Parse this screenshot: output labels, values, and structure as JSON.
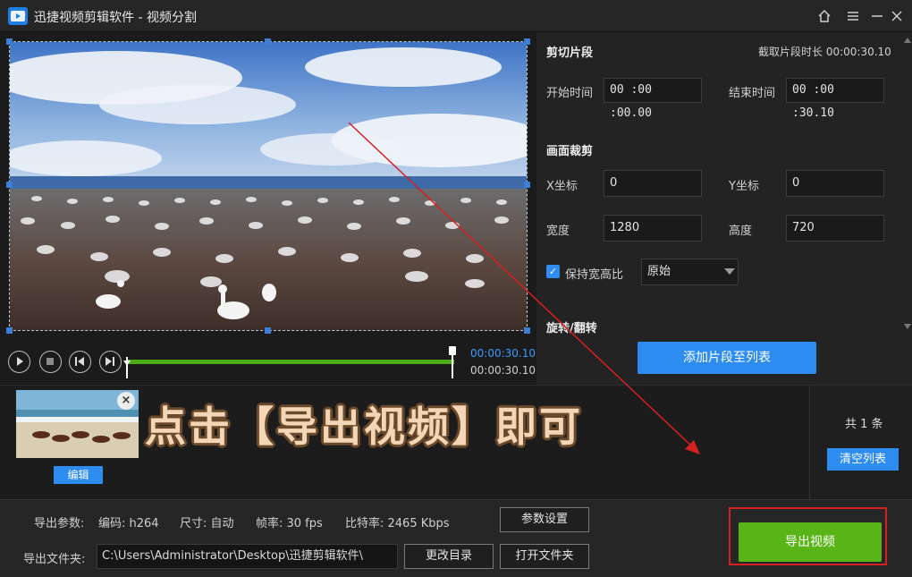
{
  "window": {
    "title": "迅捷视频剪辑软件 - 视频分割",
    "icons": [
      "home-icon",
      "menu-icon",
      "close-icon"
    ]
  },
  "player": {
    "time_current": "00:00:30.10",
    "time_total": "00:00:30.10"
  },
  "clip_section": {
    "title": "剪切片段",
    "duration_label": "截取片段时长 00:00:30.10",
    "start_label": "开始时间",
    "start_value": "00 :00 :00.00",
    "end_label": "结束时间",
    "end_value": "00 :00 :30.10"
  },
  "crop_section": {
    "title": "画面裁剪",
    "x_label": "X坐标",
    "x_value": "0",
    "y_label": "Y坐标",
    "y_value": "0",
    "width_label": "宽度",
    "width_value": "1280",
    "height_label": "高度",
    "height_value": "720",
    "keep_ratio_label": "保持宽高比",
    "keep_ratio_checked": true,
    "ratio_option": "原始"
  },
  "rotate_section": {
    "title": "旋转/翻转"
  },
  "add_clip_button": "添加片段至列表",
  "clip_list": {
    "edit_button": "编辑",
    "overlay_caption": "点击【导出视频】即可",
    "count_text": "共 1 条",
    "clear_button": "清空列表"
  },
  "export": {
    "params_label": "导出参数:",
    "codec": "编码:  h264",
    "size": "尺寸:  自动",
    "fps": "帧率:  30 fps",
    "bitrate": "比特率:  2465 Kbps",
    "settings_button": "参数设置",
    "folder_label": "导出文件夹:",
    "folder_path": "C:\\Users\\Administrator\\Desktop\\迅捷剪辑软件\\",
    "change_dir_button": "更改目录",
    "open_folder_button": "打开文件夹",
    "export_button": "导出视频"
  },
  "colors": {
    "accent_blue": "#2d8cf0",
    "timeline_green": "#4cae16",
    "export_green": "#59b417",
    "highlight_red": "#d42020",
    "caption_fill": "#f3d6b5"
  }
}
